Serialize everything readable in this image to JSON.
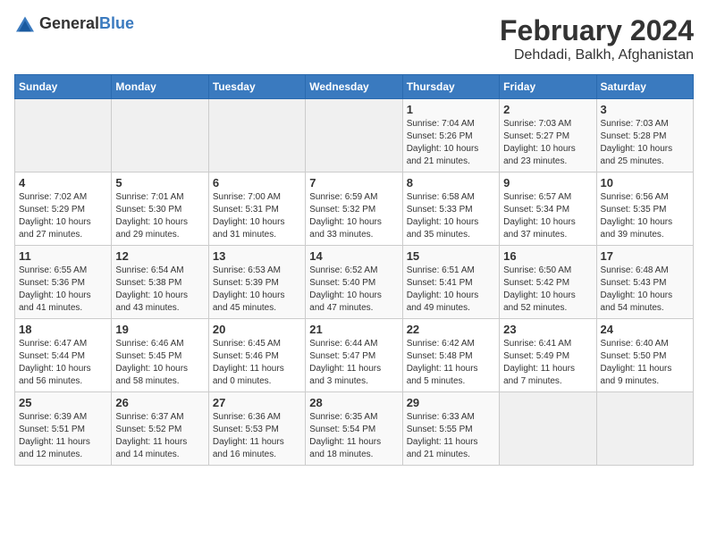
{
  "logo": {
    "text_general": "General",
    "text_blue": "Blue"
  },
  "title": "February 2024",
  "subtitle": "Dehdadi, Balkh, Afghanistan",
  "days_of_week": [
    "Sunday",
    "Monday",
    "Tuesday",
    "Wednesday",
    "Thursday",
    "Friday",
    "Saturday"
  ],
  "weeks": [
    [
      {
        "day": "",
        "info": ""
      },
      {
        "day": "",
        "info": ""
      },
      {
        "day": "",
        "info": ""
      },
      {
        "day": "",
        "info": ""
      },
      {
        "day": "1",
        "info": "Sunrise: 7:04 AM\nSunset: 5:26 PM\nDaylight: 10 hours\nand 21 minutes."
      },
      {
        "day": "2",
        "info": "Sunrise: 7:03 AM\nSunset: 5:27 PM\nDaylight: 10 hours\nand 23 minutes."
      },
      {
        "day": "3",
        "info": "Sunrise: 7:03 AM\nSunset: 5:28 PM\nDaylight: 10 hours\nand 25 minutes."
      }
    ],
    [
      {
        "day": "4",
        "info": "Sunrise: 7:02 AM\nSunset: 5:29 PM\nDaylight: 10 hours\nand 27 minutes."
      },
      {
        "day": "5",
        "info": "Sunrise: 7:01 AM\nSunset: 5:30 PM\nDaylight: 10 hours\nand 29 minutes."
      },
      {
        "day": "6",
        "info": "Sunrise: 7:00 AM\nSunset: 5:31 PM\nDaylight: 10 hours\nand 31 minutes."
      },
      {
        "day": "7",
        "info": "Sunrise: 6:59 AM\nSunset: 5:32 PM\nDaylight: 10 hours\nand 33 minutes."
      },
      {
        "day": "8",
        "info": "Sunrise: 6:58 AM\nSunset: 5:33 PM\nDaylight: 10 hours\nand 35 minutes."
      },
      {
        "day": "9",
        "info": "Sunrise: 6:57 AM\nSunset: 5:34 PM\nDaylight: 10 hours\nand 37 minutes."
      },
      {
        "day": "10",
        "info": "Sunrise: 6:56 AM\nSunset: 5:35 PM\nDaylight: 10 hours\nand 39 minutes."
      }
    ],
    [
      {
        "day": "11",
        "info": "Sunrise: 6:55 AM\nSunset: 5:36 PM\nDaylight: 10 hours\nand 41 minutes."
      },
      {
        "day": "12",
        "info": "Sunrise: 6:54 AM\nSunset: 5:38 PM\nDaylight: 10 hours\nand 43 minutes."
      },
      {
        "day": "13",
        "info": "Sunrise: 6:53 AM\nSunset: 5:39 PM\nDaylight: 10 hours\nand 45 minutes."
      },
      {
        "day": "14",
        "info": "Sunrise: 6:52 AM\nSunset: 5:40 PM\nDaylight: 10 hours\nand 47 minutes."
      },
      {
        "day": "15",
        "info": "Sunrise: 6:51 AM\nSunset: 5:41 PM\nDaylight: 10 hours\nand 49 minutes."
      },
      {
        "day": "16",
        "info": "Sunrise: 6:50 AM\nSunset: 5:42 PM\nDaylight: 10 hours\nand 52 minutes."
      },
      {
        "day": "17",
        "info": "Sunrise: 6:48 AM\nSunset: 5:43 PM\nDaylight: 10 hours\nand 54 minutes."
      }
    ],
    [
      {
        "day": "18",
        "info": "Sunrise: 6:47 AM\nSunset: 5:44 PM\nDaylight: 10 hours\nand 56 minutes."
      },
      {
        "day": "19",
        "info": "Sunrise: 6:46 AM\nSunset: 5:45 PM\nDaylight: 10 hours\nand 58 minutes."
      },
      {
        "day": "20",
        "info": "Sunrise: 6:45 AM\nSunset: 5:46 PM\nDaylight: 11 hours\nand 0 minutes."
      },
      {
        "day": "21",
        "info": "Sunrise: 6:44 AM\nSunset: 5:47 PM\nDaylight: 11 hours\nand 3 minutes."
      },
      {
        "day": "22",
        "info": "Sunrise: 6:42 AM\nSunset: 5:48 PM\nDaylight: 11 hours\nand 5 minutes."
      },
      {
        "day": "23",
        "info": "Sunrise: 6:41 AM\nSunset: 5:49 PM\nDaylight: 11 hours\nand 7 minutes."
      },
      {
        "day": "24",
        "info": "Sunrise: 6:40 AM\nSunset: 5:50 PM\nDaylight: 11 hours\nand 9 minutes."
      }
    ],
    [
      {
        "day": "25",
        "info": "Sunrise: 6:39 AM\nSunset: 5:51 PM\nDaylight: 11 hours\nand 12 minutes."
      },
      {
        "day": "26",
        "info": "Sunrise: 6:37 AM\nSunset: 5:52 PM\nDaylight: 11 hours\nand 14 minutes."
      },
      {
        "day": "27",
        "info": "Sunrise: 6:36 AM\nSunset: 5:53 PM\nDaylight: 11 hours\nand 16 minutes."
      },
      {
        "day": "28",
        "info": "Sunrise: 6:35 AM\nSunset: 5:54 PM\nDaylight: 11 hours\nand 18 minutes."
      },
      {
        "day": "29",
        "info": "Sunrise: 6:33 AM\nSunset: 5:55 PM\nDaylight: 11 hours\nand 21 minutes."
      },
      {
        "day": "",
        "info": ""
      },
      {
        "day": "",
        "info": ""
      }
    ]
  ]
}
